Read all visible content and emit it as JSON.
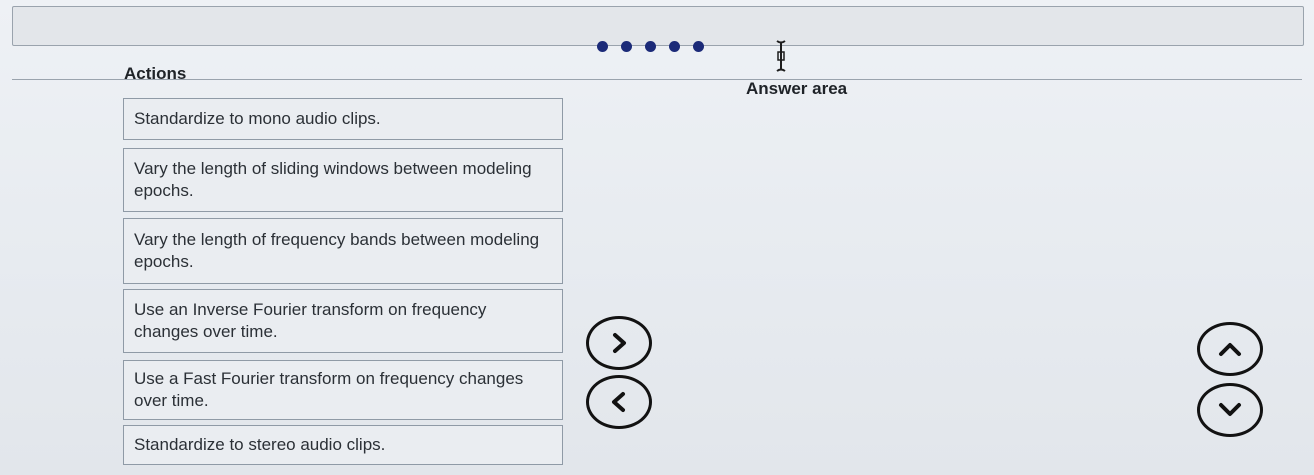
{
  "actions": {
    "heading": "Actions",
    "items": [
      {
        "label": "Standardize to mono audio clips."
      },
      {
        "label": "Vary the length of sliding windows between modeling epochs."
      },
      {
        "label": "Vary the length of frequency bands between modeling epochs."
      },
      {
        "label": "Use an Inverse Fourier transform on frequency changes over time."
      },
      {
        "label": "Use a Fast Fourier transform on frequency changes over time."
      },
      {
        "label": "Standardize to stereo audio clips."
      }
    ]
  },
  "answer_area": {
    "heading": "Answer area",
    "items": []
  },
  "controls": {
    "move_right_icon": "chevron-right-icon",
    "move_left_icon": "chevron-left-icon",
    "move_up_icon": "chevron-up-icon",
    "move_down_icon": "chevron-down-icon",
    "loading_dots": 5
  },
  "colors": {
    "dots": "#1b2a78",
    "button_outline": "#121212",
    "item_border": "#8f9aa6"
  }
}
